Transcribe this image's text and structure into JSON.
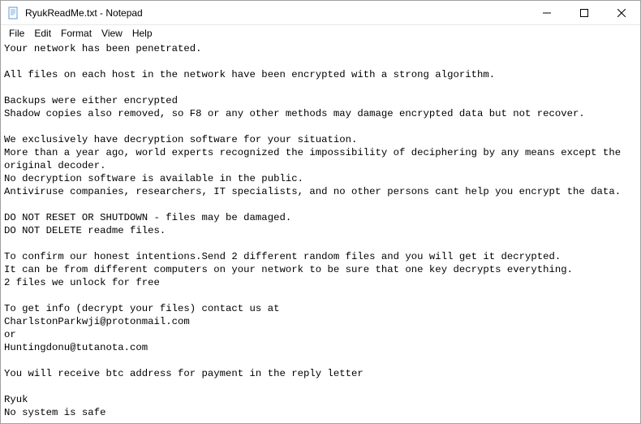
{
  "titlebar": {
    "title": "RyukReadMe.txt - Notepad"
  },
  "menu": {
    "file": "File",
    "edit": "Edit",
    "format": "Format",
    "view": "View",
    "help": "Help"
  },
  "content": {
    "text": "Your network has been penetrated.\n\nAll files on each host in the network have been encrypted with a strong algorithm.\n\nBackups were either encrypted\nShadow copies also removed, so F8 or any other methods may damage encrypted data but not recover.\n\nWe exclusively have decryption software for your situation.\nMore than a year ago, world experts recognized the impossibility of deciphering by any means except the original decoder.\nNo decryption software is available in the public.\nAntiviruse companies, researchers, IT specialists, and no other persons cant help you encrypt the data.\n\nDO NOT RESET OR SHUTDOWN - files may be damaged.\nDO NOT DELETE readme files.\n\nTo confirm our honest intentions.Send 2 different random files and you will get it decrypted.\nIt can be from different computers on your network to be sure that one key decrypts everything.\n2 files we unlock for free\n\nTo get info (decrypt your files) contact us at\nCharlstonParkwji@protonmail.com\nor\nHuntingdonu@tutanota.com\n\nYou will receive btc address for payment in the reply letter\n\nRyuk\nNo system is safe"
  }
}
